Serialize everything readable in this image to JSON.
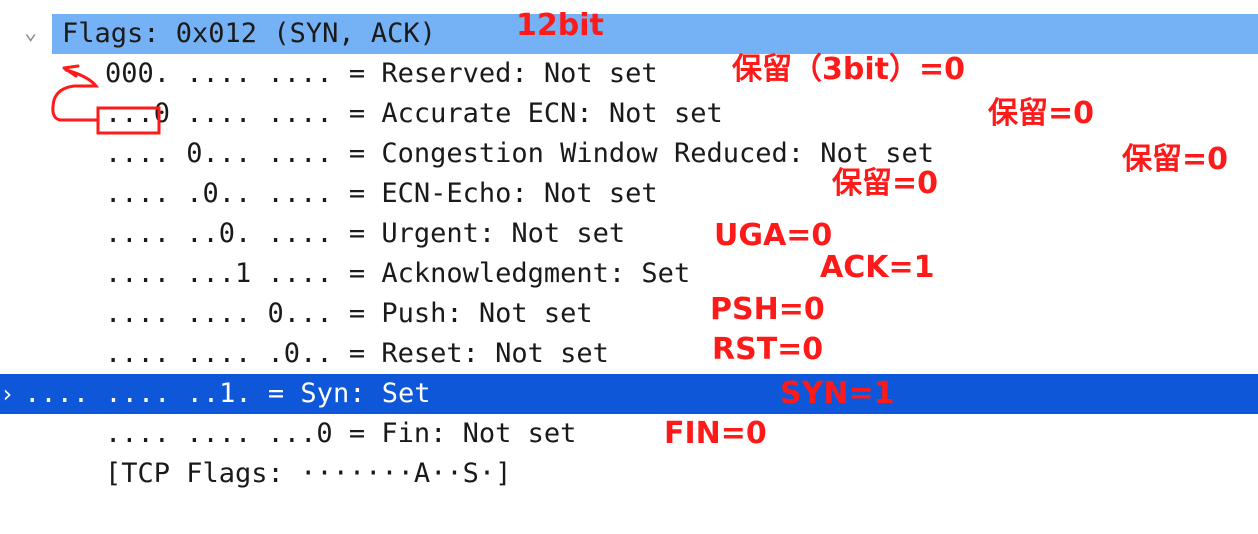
{
  "header": {
    "label": "Flags: 0x012 (SYN, ACK)",
    "expand_glyph": "⌄"
  },
  "fields": [
    {
      "text": "000. .... .... = Reserved: Not set"
    },
    {
      "text": "...0 .... .... = Accurate ECN: Not set"
    },
    {
      "text": ".... 0... .... = Congestion Window Reduced: Not set"
    },
    {
      "text": ".... .0.. .... = ECN-Echo: Not set"
    },
    {
      "text": ".... ..0. .... = Urgent: Not set"
    },
    {
      "text": ".... ...1 .... = Acknowledgment: Set"
    },
    {
      "text": ".... .... 0... = Push: Not set"
    },
    {
      "text": ".... .... .0.. = Reset: Not set"
    },
    {
      "text": ".... .... ..1. = Syn: Set",
      "expand_glyph": "›"
    },
    {
      "text": ".... .... ...0 = Fin: Not set"
    },
    {
      "text": "[TCP Flags: ·······A··S·]"
    }
  ],
  "annotations": {
    "bits": "12bit",
    "reserved": "保留（3bit）=0",
    "accurate_ecn": "保留=0",
    "cwr": "保留=0",
    "ece": "保留=0",
    "urg": "UGA=0",
    "ack": "ACK=1",
    "psh": "PSH=0",
    "rst": "RST=0",
    "syn": "SYN=1",
    "fin": "FIN=0"
  },
  "colors": {
    "header_bg": "#75b2f5",
    "selected_bg": "#0e57d9",
    "annotation": "#ff1a1a"
  }
}
